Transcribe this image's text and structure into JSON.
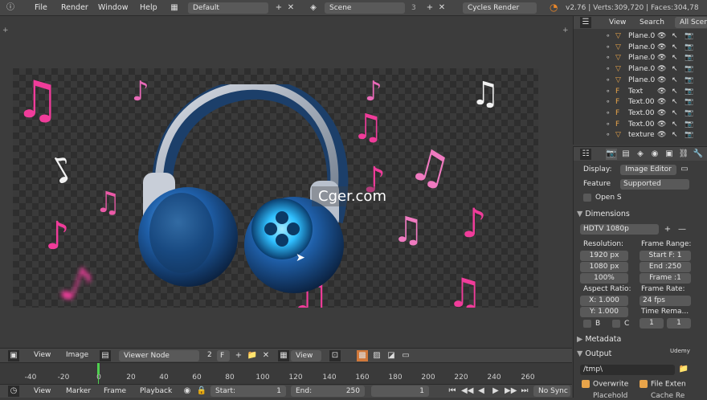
{
  "topbar": {
    "menus": [
      "File",
      "Render",
      "Window",
      "Help"
    ],
    "layout": "Default",
    "scene": "Scene",
    "scene_users": "3",
    "engine": "Cycles Render",
    "stats": "v2.76 | Verts:309,720 | Faces:304,78"
  },
  "outliner": {
    "tabs": [
      "View",
      "Search",
      "All Scene"
    ],
    "items": [
      {
        "name": "Plane.0",
        "type": "mesh"
      },
      {
        "name": "Plane.0",
        "type": "mesh"
      },
      {
        "name": "Plane.0",
        "type": "mesh"
      },
      {
        "name": "Plane.0",
        "type": "mesh"
      },
      {
        "name": "Plane.0",
        "type": "mesh"
      },
      {
        "name": "Text",
        "type": "text"
      },
      {
        "name": "Text.00",
        "type": "text"
      },
      {
        "name": "Text.00",
        "type": "text"
      },
      {
        "name": "Text.00",
        "type": "text"
      },
      {
        "name": "texture",
        "type": "mesh"
      }
    ]
  },
  "props": {
    "display_label": "Display:",
    "display_value": "Image Editor",
    "feature_label": "Feature",
    "feature_value": "Supported",
    "open_shading": "Open S",
    "dimensions_title": "Dimensions",
    "preset": "HDTV 1080p",
    "resolution_label": "Resolution:",
    "res_x": "1920 px",
    "res_y": "1080 px",
    "res_pct": "100%",
    "frame_range_label": "Frame Range:",
    "start_frame": "Start F: 1",
    "end_frame": "End :250",
    "frame_step": "Frame :1",
    "aspect_label": "Aspect Ratio:",
    "aspect_x": "X: 1.000",
    "aspect_y": "Y: 1.000",
    "frame_rate_label": "Frame Rate:",
    "fps": "24 fps",
    "time_remap_label": "Time Rema...",
    "remap_old": "1",
    "remap_new": "1",
    "border_b": "B",
    "border_c": "C",
    "metadata_title": "Metadata",
    "output_title": "Output",
    "output_path": "/tmp\\",
    "overwrite": "Overwrite",
    "file_ext": "File Exten",
    "placeholder": "Placehold",
    "cache_result": "Cache Re",
    "udemy": "Udemy"
  },
  "viewer_header": {
    "view": "View",
    "image": "Image",
    "node": "Viewer Node",
    "users": "2",
    "fake": "F",
    "view2": "View"
  },
  "timeline": {
    "ticks": [
      "-40",
      "-20",
      "0",
      "20",
      "40",
      "60",
      "80",
      "100",
      "120",
      "140",
      "160",
      "180",
      "200",
      "220",
      "240",
      "260"
    ],
    "current_frame": 0,
    "menus": [
      "View",
      "Marker",
      "Frame",
      "Playback"
    ],
    "start_label": "Start:",
    "start_value": "1",
    "end_label": "End:",
    "end_value": "250",
    "current_value": "1",
    "sync": "No Sync"
  },
  "watermark": "Cger.com",
  "colors": {
    "note_pink": "#f03c9a",
    "note_white": "#f2f2f2",
    "headphone_blue": "#2b78c4",
    "accent_orange": "#e8a44a"
  }
}
